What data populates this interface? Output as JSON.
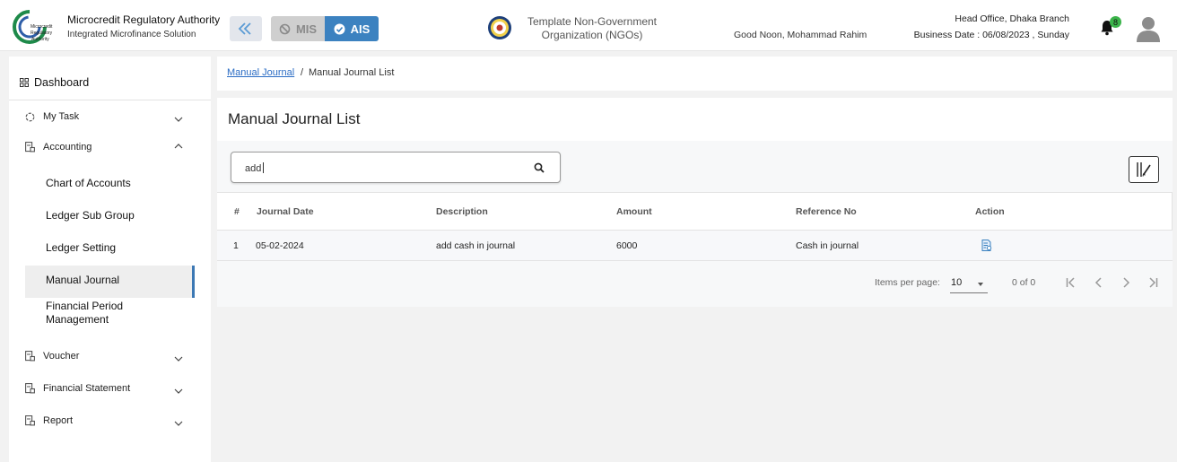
{
  "header": {
    "org_title": "Microcredit Regulatory Authority",
    "org_subtitle": "Integrated Microfinance Solution",
    "logo_text": [
      "Microcredit",
      "Regulatory",
      "Authority"
    ],
    "mis_label": "MIS",
    "ais_label": "AIS",
    "ngo_name_line1": "Template Non-Government",
    "ngo_name_line2": "Organization (NGOs)",
    "greeting": "Good Noon, Mohammad Rahim",
    "branch": "Head Office, Dhaka Branch",
    "business_date": "Business Date : 06/08/2023 , Sunday",
    "notification_count": "8",
    "accent_color": "#3c82c0"
  },
  "sidebar": {
    "dashboard": "Dashboard",
    "items": [
      {
        "label": "My Task",
        "icon": "spinner-icon",
        "expanded": false
      },
      {
        "label": "Accounting",
        "icon": "ledger-icon",
        "expanded": true
      },
      {
        "label": "Voucher",
        "icon": "ledger-icon",
        "expanded": false
      },
      {
        "label": "Financial Statement",
        "icon": "ledger-icon",
        "expanded": false
      },
      {
        "label": "Report",
        "icon": "ledger-icon",
        "expanded": false
      }
    ],
    "accounting_sub": [
      "Chart of Accounts",
      "Ledger Sub Group",
      "Ledger Setting",
      "Manual Journal",
      "Financial Period",
      "Management"
    ],
    "active_sub": "Manual Journal"
  },
  "breadcrumb": {
    "parent": "Manual Journal",
    "separator": "/",
    "current": "Manual Journal List"
  },
  "list": {
    "title": "Manual Journal List",
    "search_value": "add",
    "columns": [
      "#",
      "Journal Date",
      "Description",
      "Amount",
      "Reference No",
      "Action"
    ],
    "rows": [
      {
        "index": "1",
        "date": "05-02-2024",
        "description": "add cash in journal",
        "amount": "6000",
        "reference": "Cash in journal"
      }
    ]
  },
  "paginator": {
    "items_per_page_label": "Items per page:",
    "items_per_page": "10",
    "range": "0 of 0"
  }
}
